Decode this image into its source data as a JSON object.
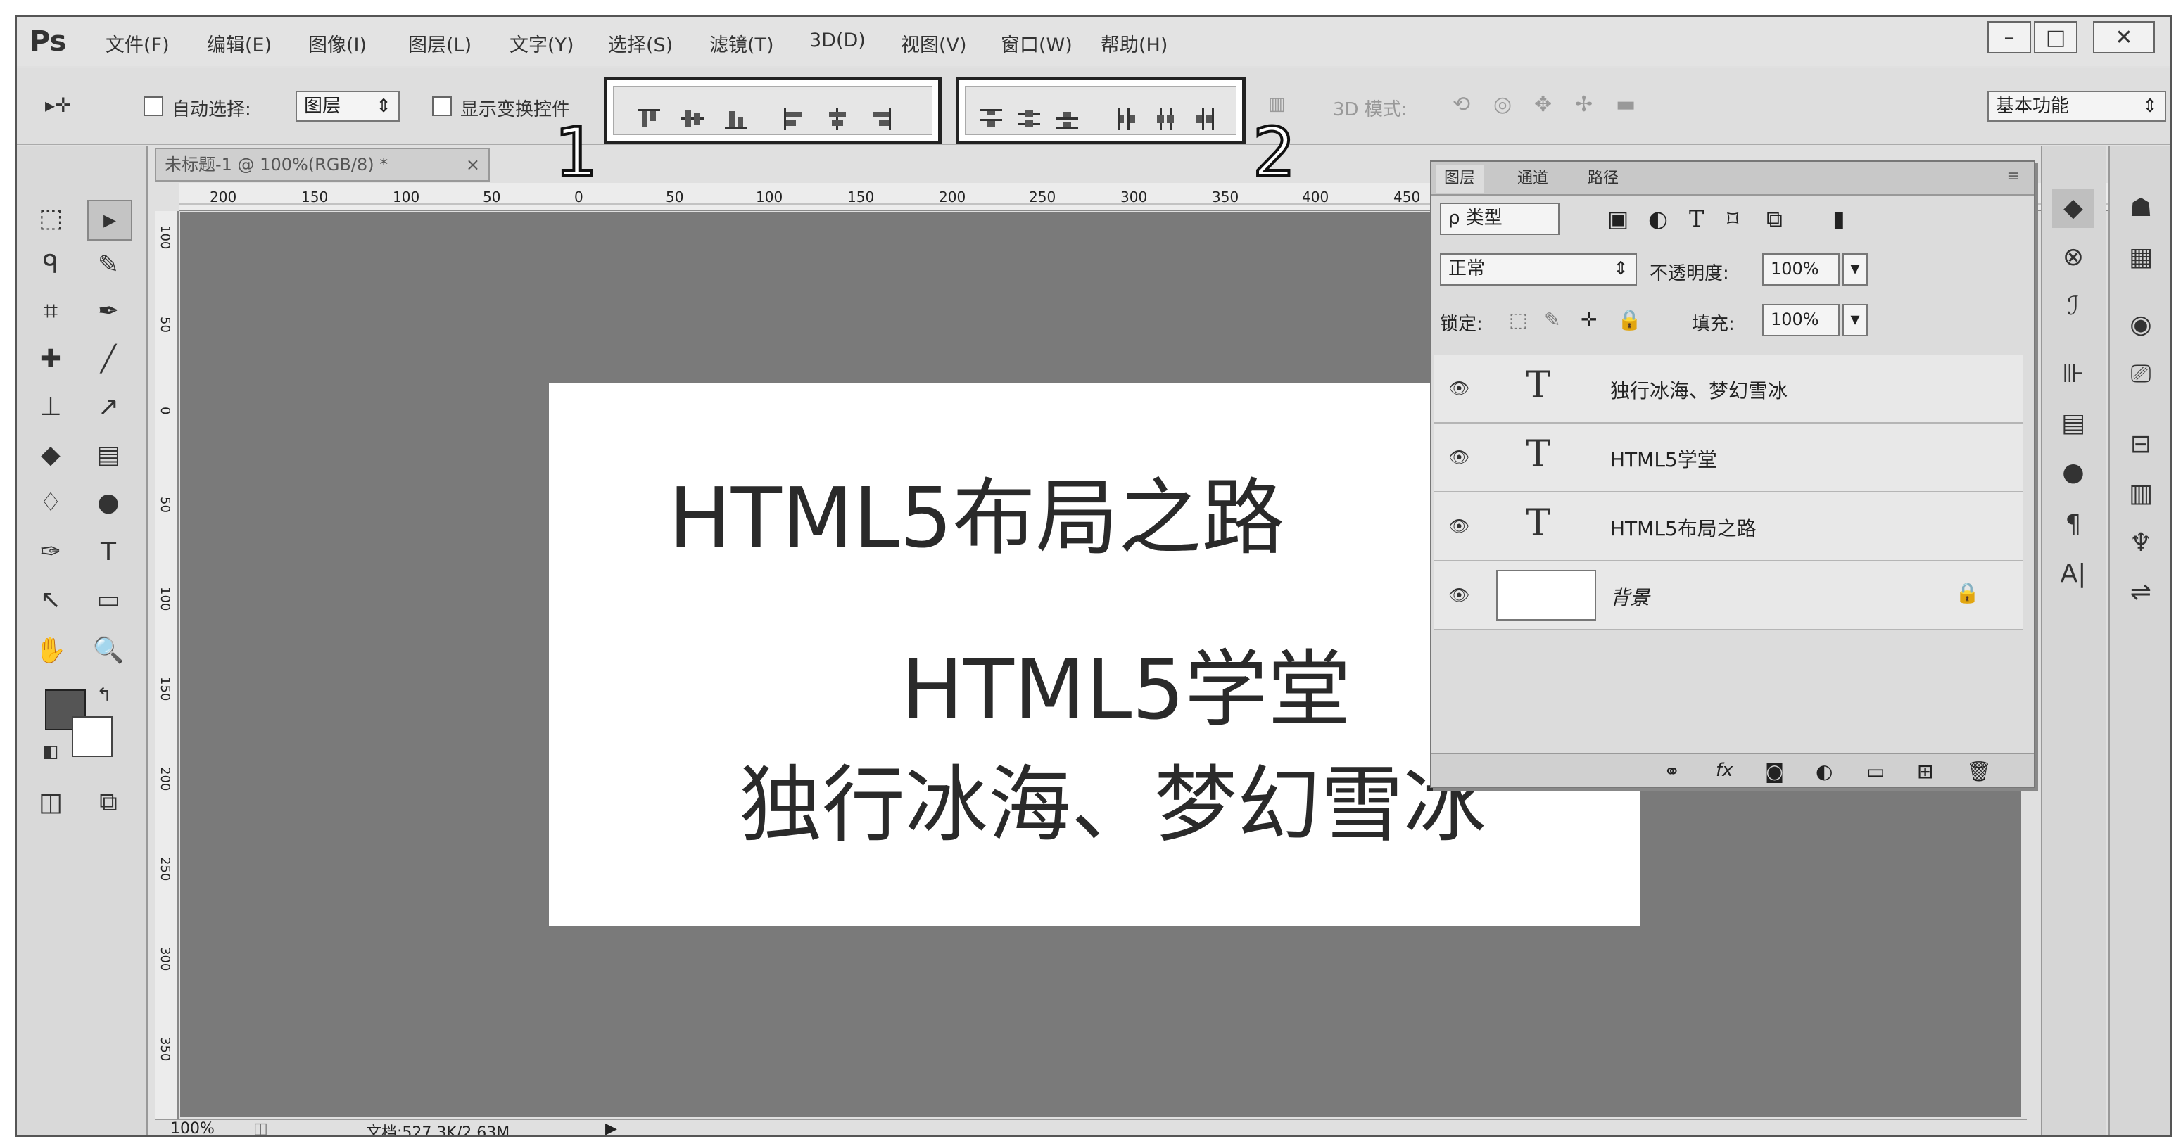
{
  "app": {
    "logo": "Ps"
  },
  "menu": [
    "文件(F)",
    "编辑(E)",
    "图像(I)",
    "图层(L)",
    "文字(Y)",
    "选择(S)",
    "滤镜(T)",
    "3D(D)",
    "视图(V)",
    "窗口(W)",
    "帮助(H)"
  ],
  "window_controls": {
    "minimize": "–",
    "maximize": "□",
    "close": "✕"
  },
  "options": {
    "move_tool_glyph": "▸✛",
    "auto_select_label": "自动选择:",
    "auto_select_value": "图层",
    "show_transform_label": "显示变换控件",
    "mode_3d_label": "3D 模式:",
    "workspace": "基本功能"
  },
  "callouts": {
    "group1": "1",
    "group2": "2"
  },
  "document": {
    "tab_title": "未标题-1 @ 100%(RGB/8) *",
    "texts": {
      "line1": "HTML5布局之路",
      "line2": "HTML5学堂",
      "line3": "独行冰海、梦幻雪冰"
    }
  },
  "rulers": {
    "horizontal": [
      "200",
      "150",
      "100",
      "50",
      "0",
      "50",
      "100",
      "150",
      "200",
      "250",
      "300",
      "350",
      "400",
      "450"
    ],
    "vertical": [
      "100",
      "50",
      "0",
      "50",
      "100",
      "150",
      "200",
      "250",
      "300",
      "350"
    ]
  },
  "status": {
    "zoom": "100%",
    "doc_info": "文档:527.3K/2.63M"
  },
  "layers_panel": {
    "tabs": [
      "图层",
      "通道",
      "路径"
    ],
    "filter_kind": "ρ 类型",
    "blend_mode": "正常",
    "opacity_label": "不透明度:",
    "opacity_value": "100%",
    "lock_label": "锁定:",
    "fill_label": "填充:",
    "fill_value": "100%",
    "layers": [
      {
        "type": "T",
        "name": "独行冰海、梦幻雪冰"
      },
      {
        "type": "T",
        "name": "HTML5学堂"
      },
      {
        "type": "T",
        "name": "HTML5布局之路"
      },
      {
        "type": "image",
        "name": "背景"
      }
    ],
    "footer_icons": [
      "link-icon",
      "fx-icon",
      "mask-icon",
      "adjustment-icon",
      "group-icon",
      "new-layer-icon",
      "trash-icon"
    ]
  },
  "colors": {
    "canvas_bg": "#7a7a7a",
    "panel_bg": "#dcdcdc",
    "ui_bg": "#e0e0e0"
  }
}
